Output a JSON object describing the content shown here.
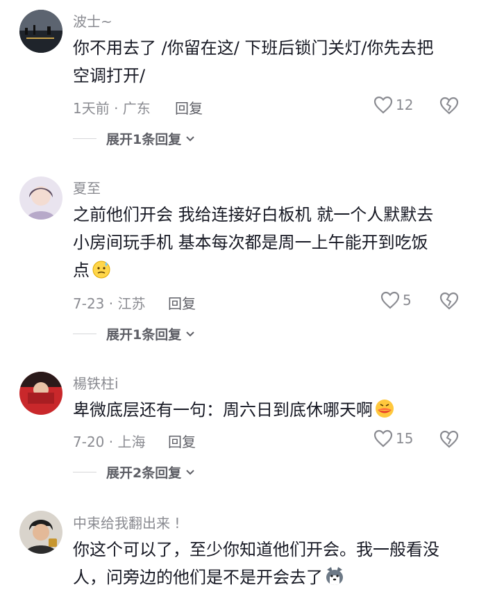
{
  "comments": [
    {
      "username": "波士~",
      "lines": [
        "你不用去了 /你留在这/ 下班后锁门关灯/你先去把",
        "空调打开/"
      ],
      "time": "1天前 · 广东",
      "reply_label": "回复",
      "likes": "12",
      "expand_label": "展开1条回复"
    },
    {
      "username": "夏至",
      "lines": [
        "之前他们开会  我给连接好白板机  就一个人默默去",
        "小房间玩手机  基本每次都是周一上午能开到吃饭",
        "点"
      ],
      "emoji": "sweat-face-emoji",
      "time": "7-23 · 江苏",
      "reply_label": "回复",
      "likes": "5",
      "expand_label": "展开1条回复"
    },
    {
      "username": "楊铁柱i",
      "lines": [
        "卑微底层还有一句：周六日到底休哪天啊"
      ],
      "emoji": "crying-lips-emoji",
      "time": "7-20 · 上海",
      "reply_label": "回复",
      "likes": "15",
      "expand_label": "展开2条回复"
    },
    {
      "username": "中束给我翻出来 !",
      "lines": [
        "你这个可以了，至少你知道他们开会。我一般看没",
        "人，问旁边的他们是不是开会去了"
      ],
      "emoji": "husky-emoji"
    }
  ],
  "colors": {
    "text": "#161823",
    "secondary": "#8a8b91",
    "reply": "#5d5e65"
  }
}
